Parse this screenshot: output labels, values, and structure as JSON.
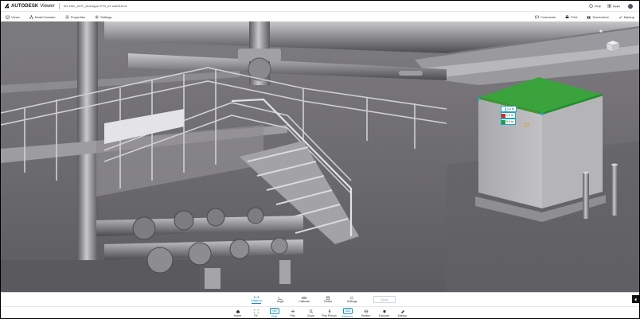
{
  "header": {
    "brand": "AUTODESK",
    "product": "Viewer",
    "filename": "SG-HDL_DHT_Architype STS_01.sd2018.rvt",
    "right_buttons": [
      {
        "label": "Help",
        "icon": "help-icon"
      },
      {
        "label": "Apps",
        "icon": "apps-grid-icon"
      }
    ]
  },
  "toolbar": {
    "left": [
      {
        "label": "Views",
        "icon": "views-icon"
      },
      {
        "label": "Model browser",
        "icon": "model-browser-icon"
      },
      {
        "label": "Properties",
        "icon": "properties-icon"
      },
      {
        "label": "Settings",
        "icon": "settings-icon"
      }
    ],
    "right": [
      {
        "label": "Comments",
        "icon": "comments-icon"
      },
      {
        "label": "Print",
        "icon": "print-icon"
      },
      {
        "label": "Screenshot",
        "icon": "screenshot-icon"
      },
      {
        "label": "Markup",
        "icon": "markup-icon"
      }
    ]
  },
  "measurement": {
    "tags": [
      {
        "label": "1.2 m",
        "color": "#ffffff"
      },
      {
        "label": "1.2 m",
        "color": "#e02424"
      },
      {
        "label": "0.4 m",
        "color": "#16a34a"
      }
    ],
    "highlight_color": "#3aa33c",
    "accent_color": "#1aa7c2"
  },
  "measure_panel": {
    "tools": [
      {
        "label": "Distance",
        "icon": "distance-icon",
        "active": true
      },
      {
        "label": "Angle",
        "icon": "angle-icon",
        "active": false
      },
      {
        "label": "Calibrate",
        "icon": "calibrate-icon",
        "active": false
      },
      {
        "label": "Delete",
        "icon": "delete-icon",
        "active": false
      },
      {
        "label": "Settings",
        "icon": "settings-icon",
        "active": false
      }
    ],
    "done_label": "Done"
  },
  "bottom_toolbar": {
    "tools": [
      {
        "label": "Home",
        "icon": "home-icon"
      },
      {
        "label": "Fit",
        "icon": "fit-icon"
      },
      {
        "label": "Orbit",
        "icon": "orbit-icon"
      },
      {
        "label": "Pan",
        "icon": "pan-icon"
      },
      {
        "label": "Zoom",
        "icon": "zoom-icon"
      },
      {
        "label": "First Person",
        "icon": "first-person-icon"
      },
      {
        "label": "Measure",
        "icon": "measure-icon"
      },
      {
        "label": "Section",
        "icon": "section-icon"
      },
      {
        "label": "Explode",
        "icon": "explode-icon"
      },
      {
        "label": "Markup",
        "icon": "markup-icon"
      }
    ],
    "active": "Measure"
  },
  "colors": {
    "accent": "#1791c9",
    "viewport_bg": "#6f6e72"
  }
}
